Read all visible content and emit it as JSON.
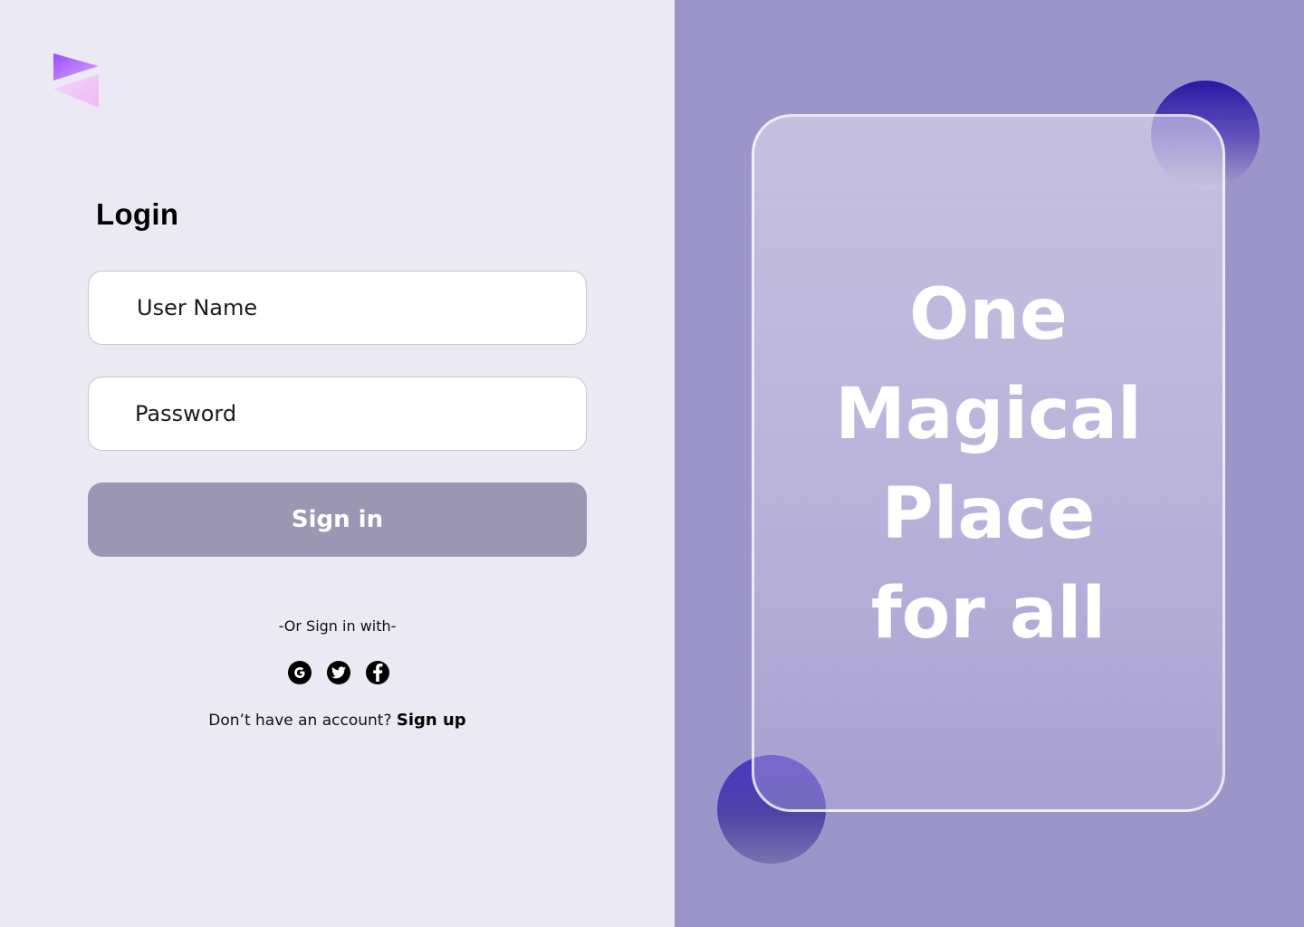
{
  "brand": {
    "logo": "logo-triangles-mark"
  },
  "login": {
    "title": "Login",
    "username_placeholder": "User Name",
    "password_placeholder": "Password",
    "signin_label": "Sign in",
    "or_text": "-Or Sign in with-",
    "socials": [
      "google-icon",
      "twitter-icon",
      "facebook-icon"
    ],
    "no_account_text": "Don’t have an account? ",
    "signup_label": "Sign up"
  },
  "hero": {
    "lines": [
      "One",
      "Magical",
      "Place",
      "for all"
    ]
  },
  "colors": {
    "left_background": "#ebe9f4",
    "right_background": "#9c95c9",
    "button": "#9b97b3",
    "accent_circle": "#2a18a6"
  }
}
